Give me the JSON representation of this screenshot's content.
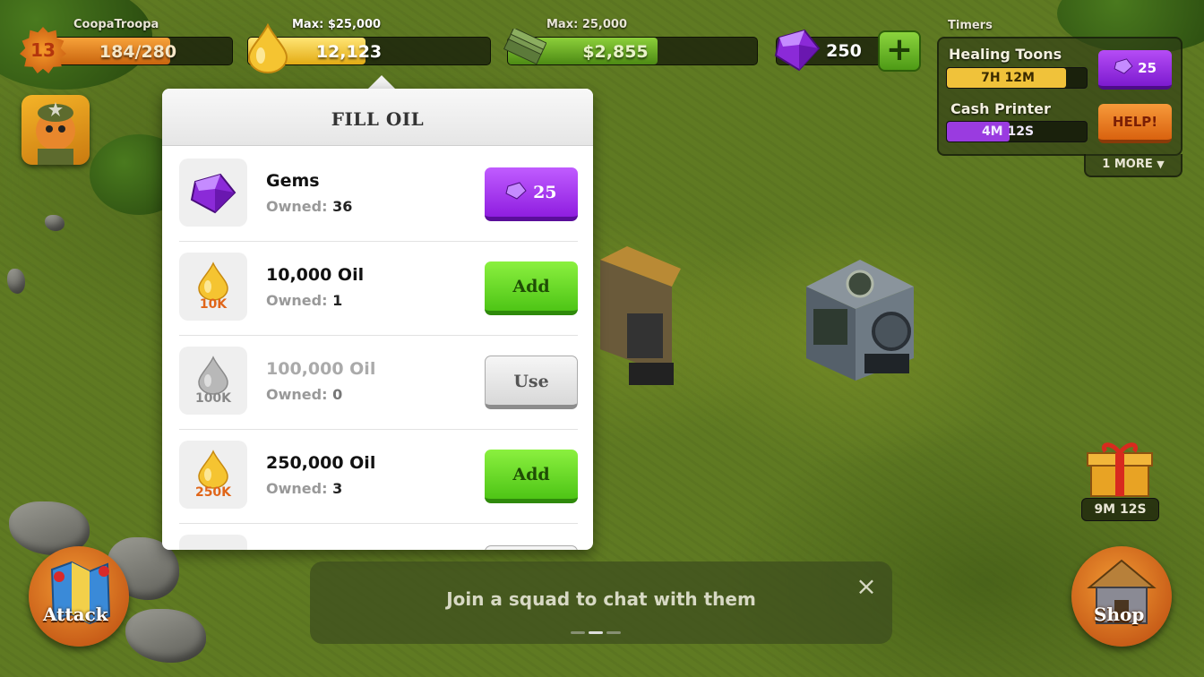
{
  "player": {
    "name": "CoopaTroopa",
    "level": "13",
    "xp": "184/280",
    "xp_fraction": 0.657
  },
  "resources": {
    "oil": {
      "max_label": "Max: $25,000",
      "value": "12,123",
      "fill_fraction": 0.485
    },
    "cash": {
      "max_label": "Max: 25,000",
      "value": "$2,855",
      "fill_fraction": 0.6
    },
    "gems": {
      "value": "250",
      "add_symbol": "+"
    }
  },
  "dialog": {
    "title": "FILL OIL",
    "owned_label": "Owned:",
    "items": [
      {
        "title": "Gems",
        "owned": "36",
        "icon": "gem-icon",
        "button": "25",
        "button_style": "purple"
      },
      {
        "title": "10,000 Oil",
        "owned": "1",
        "icon": "oil-drop-icon",
        "icon_label": "10K",
        "button": "Add",
        "button_style": "green"
      },
      {
        "title": "100,000 Oil",
        "owned": "0",
        "icon": "oil-drop-icon",
        "icon_label": "100K",
        "button": "Use",
        "button_style": "gray",
        "disabled": true
      },
      {
        "title": "250,000 Oil",
        "owned": "3",
        "icon": "oil-drop-icon",
        "icon_label": "250K",
        "button": "Add",
        "button_style": "green"
      }
    ]
  },
  "timers": {
    "heading": "Timers",
    "items": [
      {
        "name": "Healing Toons",
        "time": "7H 12M",
        "fill_fraction": 0.85,
        "color": "#f0c23a",
        "action": "25",
        "action_style": "purple"
      },
      {
        "name": "Cash Printer",
        "time": "4M 12S",
        "fill_fraction": 0.45,
        "color": "#9a3be0",
        "action": "HELP!",
        "action_style": "orange"
      }
    ],
    "more_label": "1 MORE"
  },
  "gift": {
    "time": "9M 12S"
  },
  "chat": {
    "text": "Join a squad to chat with them",
    "close": "×",
    "pages": 3,
    "active_page": 1
  },
  "buttons": {
    "attack": "Attack",
    "shop": "Shop"
  },
  "colors": {
    "gem_purple": "#8f1ee0",
    "add_green": "#4ec516",
    "oil_gold": "#f5c431",
    "cash_green": "#6fbf24"
  }
}
